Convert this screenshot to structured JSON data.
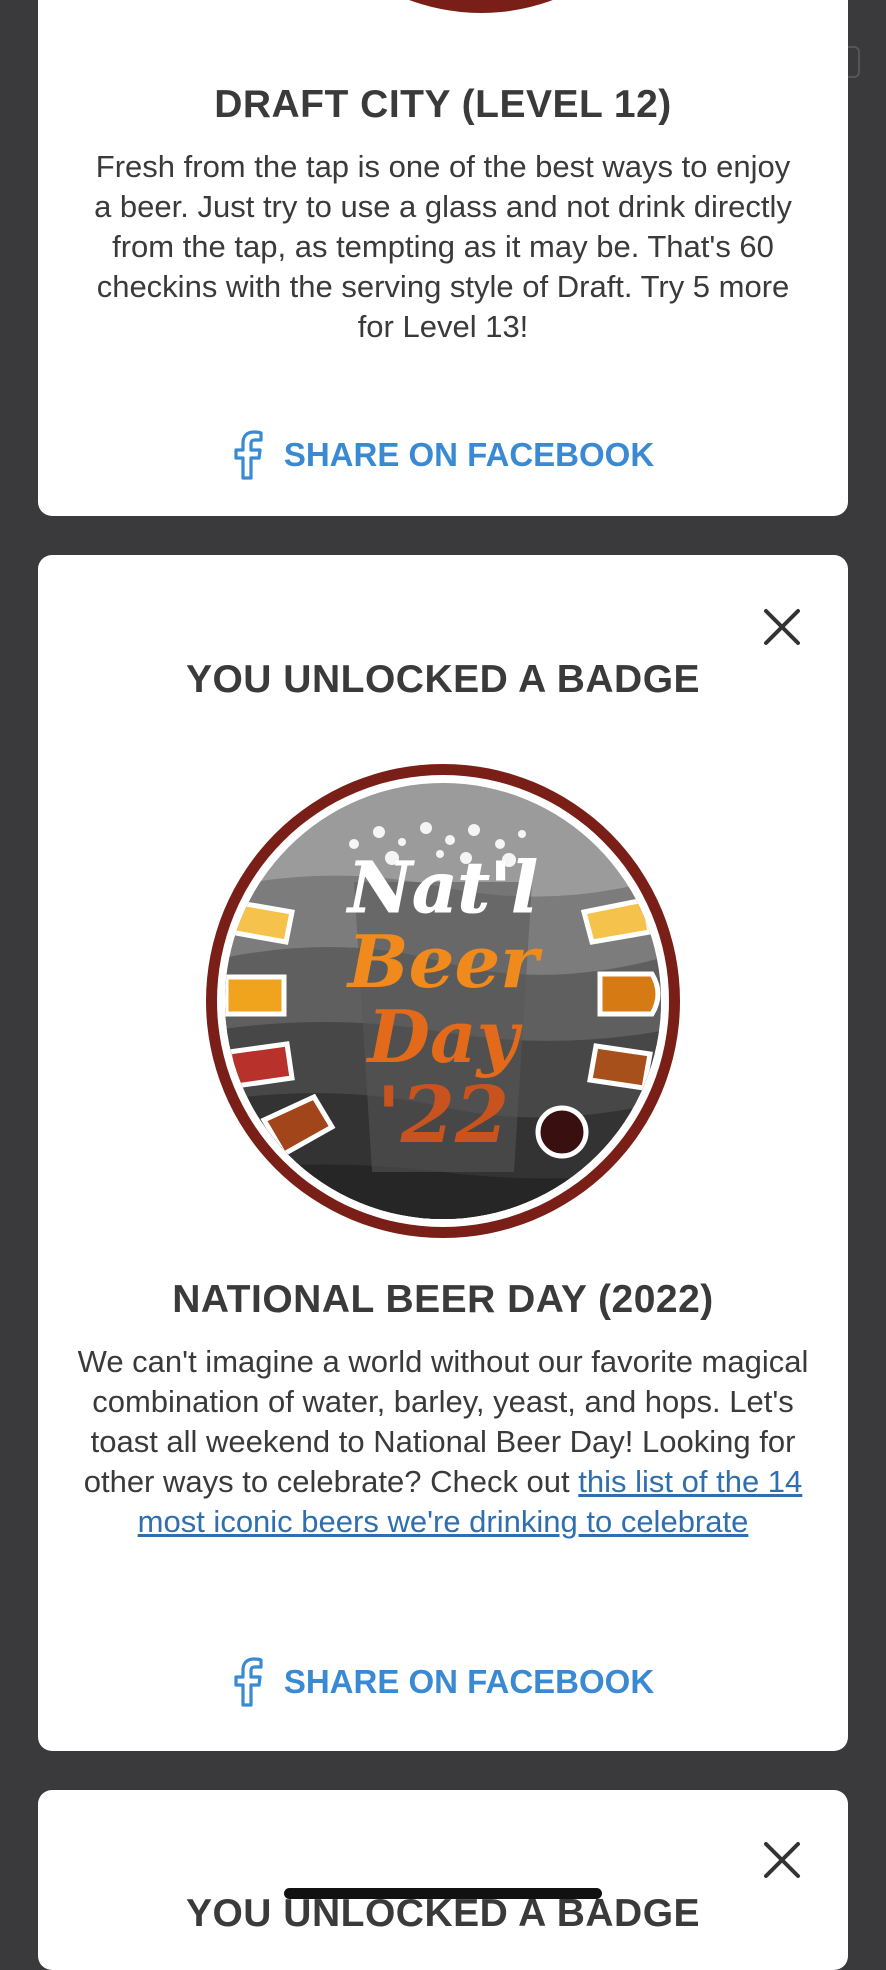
{
  "cards": [
    {
      "title": "DRAFT CITY (LEVEL 12)",
      "description": "Fresh from the tap is one of the best ways to enjoy a beer. Just try to use a glass and not drink directly from the tap, as tempting as it may be. That's 60 checkins with the serving style of Draft. Try 5 more for Level 13!",
      "share_label": "SHARE ON FACEBOOK"
    },
    {
      "header": "YOU UNLOCKED A BADGE",
      "badge_art_text": [
        "Nat'l",
        "Beer",
        "Day",
        "'22"
      ],
      "title": "NATIONAL BEER DAY (2022)",
      "description_prefix": "We can't imagine a world without our favorite magical combination of water, barley, yeast, and hops. Let's toast all weekend to National Beer Day! Looking for other ways to celebrate? Check out ",
      "description_link": "this list of the 14 most iconic beers we're drinking to celebrate",
      "share_label": "SHARE ON FACEBOOK"
    },
    {
      "header": "YOU UNLOCKED A BADGE"
    }
  ],
  "icons": {
    "share": "facebook-icon",
    "close": "close-icon"
  },
  "colors": {
    "background": "#3a3a3c",
    "card": "#ffffff",
    "text": "#3a3a3a",
    "share_blue": "#3a8ad3",
    "link_blue": "#2f6fb0",
    "badge_ring": "#7a1f17"
  }
}
